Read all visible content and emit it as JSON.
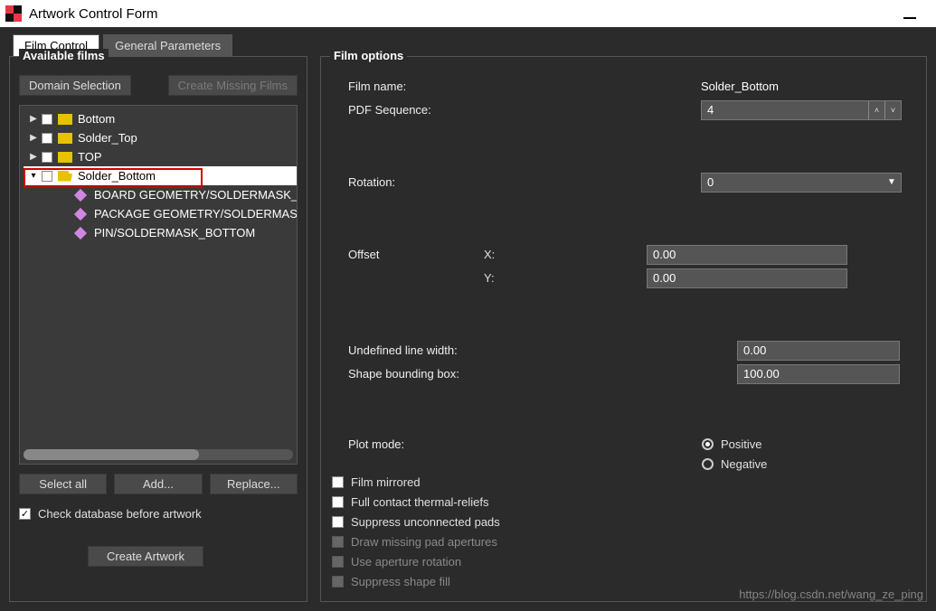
{
  "window": {
    "title": "Artwork Control Form"
  },
  "tabs": {
    "film_control": "Film Control",
    "general_parameters": "General Parameters"
  },
  "left": {
    "legend": "Available films",
    "domain_selection": "Domain Selection",
    "create_missing": "Create Missing Films",
    "films": [
      {
        "name": "Bottom",
        "expanded": false
      },
      {
        "name": "Solder_Top",
        "expanded": false
      },
      {
        "name": "TOP",
        "expanded": false
      },
      {
        "name": "Solder_Bottom",
        "expanded": true,
        "selected": true,
        "children": [
          "BOARD GEOMETRY/SOLDERMASK_BOTTOM",
          "PACKAGE GEOMETRY/SOLDERMASK_BOTTOM",
          "PIN/SOLDERMASK_BOTTOM"
        ]
      }
    ],
    "buttons": {
      "select_all": "Select all",
      "add": "Add...",
      "replace": "Replace..."
    },
    "check_db": "Check database before artwork",
    "create_artwork": "Create Artwork"
  },
  "right": {
    "legend": "Film options",
    "film_name_label": "Film name:",
    "film_name_value": "Solder_Bottom",
    "pdf_seq_label": "PDF Sequence:",
    "pdf_seq_value": "4",
    "rotation_label": "Rotation:",
    "rotation_value": "0",
    "offset_label": "Offset",
    "x_label": "X:",
    "y_label": "Y:",
    "offset_x": "0.00",
    "offset_y": "0.00",
    "undef_line_label": "Undefined line width:",
    "undef_line_value": "0.00",
    "shape_bb_label": "Shape bounding box:",
    "shape_bb_value": "100.00",
    "plot_mode_label": "Plot mode:",
    "plot_positive": "Positive",
    "plot_negative": "Negative",
    "opt_film_mirrored": "Film mirrored",
    "opt_full_contact": "Full contact thermal-reliefs",
    "opt_suppress_pads": "Suppress unconnected pads",
    "opt_draw_missing": "Draw missing pad apertures",
    "opt_aperture_rot": "Use aperture rotation",
    "opt_suppress_shape": "Suppress shape fill"
  },
  "watermark": "https://blog.csdn.net/wang_ze_ping"
}
